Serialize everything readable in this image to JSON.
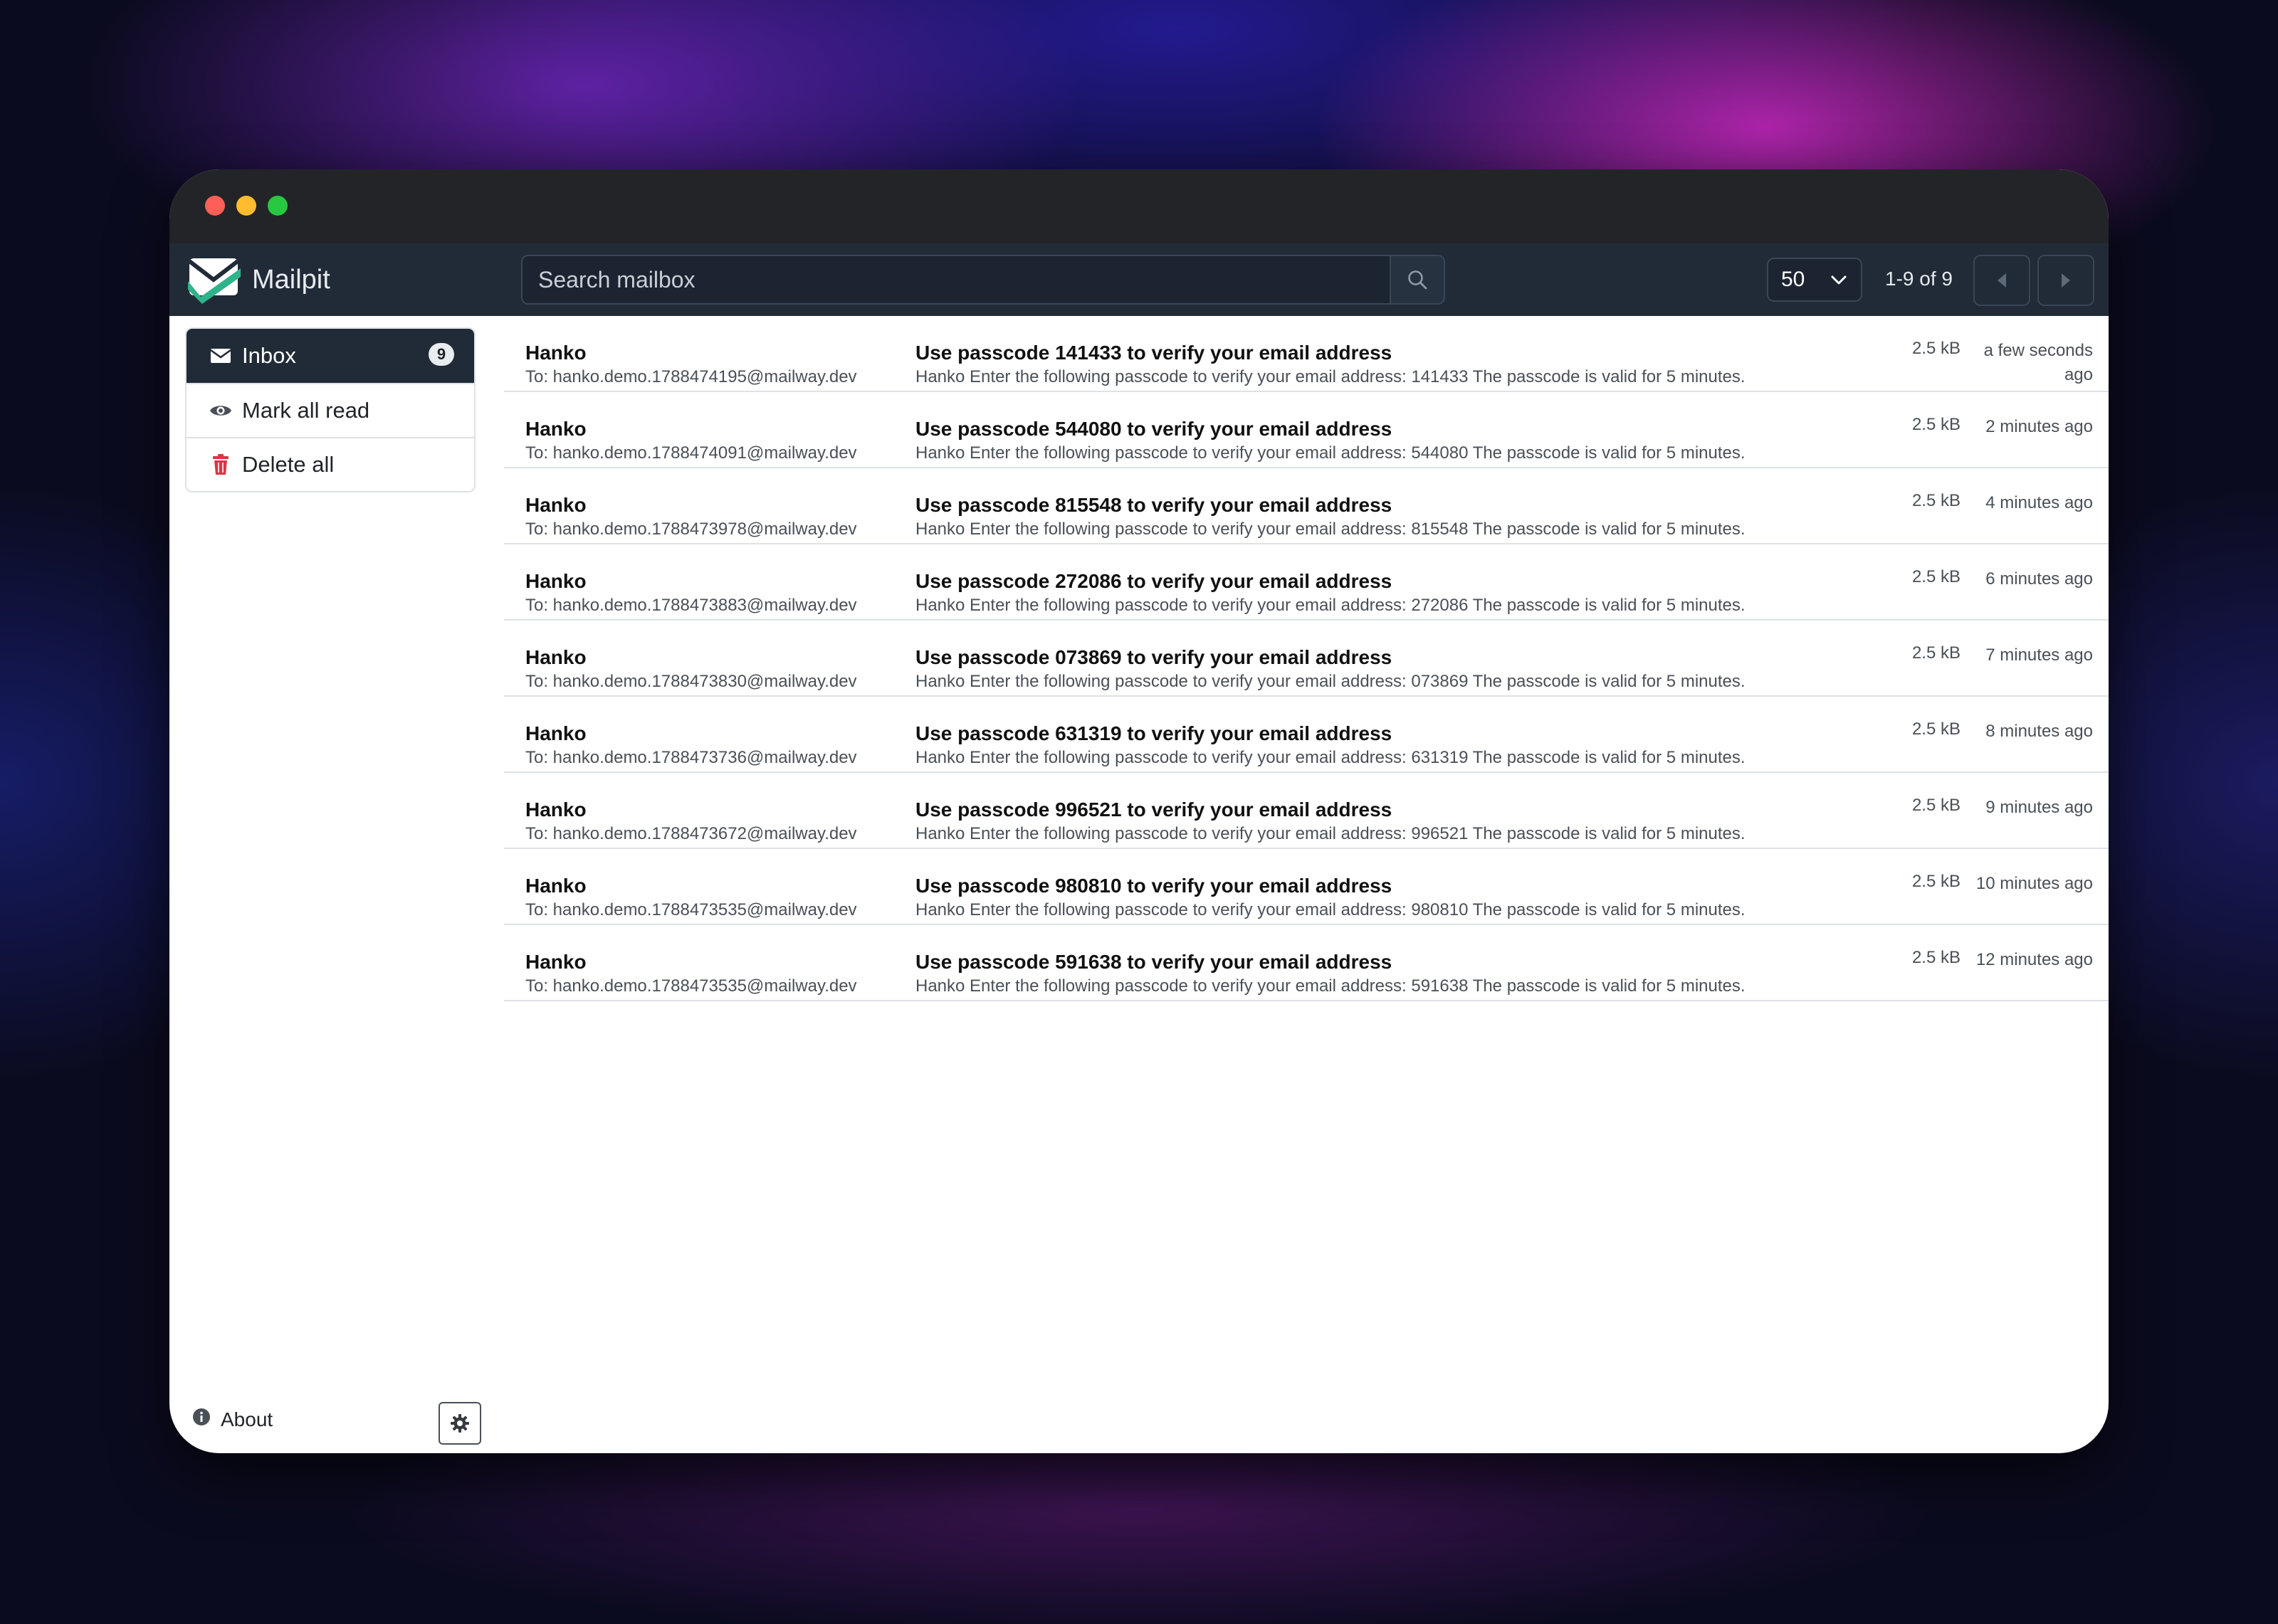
{
  "window": {
    "controls": [
      "close",
      "minimize",
      "zoom"
    ]
  },
  "navbar": {
    "brand_name": "Mailpit",
    "search_placeholder": "Search mailbox",
    "per_page": "50",
    "page_count": "1-9 of 9",
    "icons": {
      "logo": "mailpit-logo-icon",
      "search": "search-icon",
      "prev": "caret-left-icon",
      "next": "caret-right-icon",
      "dropdown": "chevron-down-icon"
    }
  },
  "sidebar": {
    "items": [
      {
        "label": "Inbox",
        "icon": "envelope-icon",
        "badge": "9",
        "active": true
      },
      {
        "label": "Mark all read",
        "icon": "eye-icon"
      },
      {
        "label": "Delete all",
        "icon": "trash-icon"
      }
    ],
    "about_label": "About",
    "colors": {
      "accent": "#212b37",
      "danger": "#dc3545"
    }
  },
  "messages": [
    {
      "from": "Hanko",
      "to": "To: hanko.demo.1788474195@mailway.dev",
      "subject": "Use passcode 141433 to verify your email address",
      "snippet": "Hanko Enter the following passcode to verify your email address: 141433 The passcode is valid for 5 minutes.",
      "size": "2.5 kB",
      "time_line1": "a few seconds",
      "time_line2": "ago"
    },
    {
      "from": "Hanko",
      "to": "To: hanko.demo.1788474091@mailway.dev",
      "subject": "Use passcode 544080 to verify your email address",
      "snippet": "Hanko Enter the following passcode to verify your email address: 544080 The passcode is valid for 5 minutes.",
      "size": "2.5 kB",
      "time_line1": "2 minutes ago",
      "time_line2": ""
    },
    {
      "from": "Hanko",
      "to": "To: hanko.demo.1788473978@mailway.dev",
      "subject": "Use passcode 815548 to verify your email address",
      "snippet": "Hanko Enter the following passcode to verify your email address: 815548 The passcode is valid for 5 minutes.",
      "size": "2.5 kB",
      "time_line1": "4 minutes ago",
      "time_line2": ""
    },
    {
      "from": "Hanko",
      "to": "To: hanko.demo.1788473883@mailway.dev",
      "subject": "Use passcode 272086 to verify your email address",
      "snippet": "Hanko Enter the following passcode to verify your email address: 272086 The passcode is valid for 5 minutes.",
      "size": "2.5 kB",
      "time_line1": "6 minutes ago",
      "time_line2": ""
    },
    {
      "from": "Hanko",
      "to": "To: hanko.demo.1788473830@mailway.dev",
      "subject": "Use passcode 073869 to verify your email address",
      "snippet": "Hanko Enter the following passcode to verify your email address: 073869 The passcode is valid for 5 minutes.",
      "size": "2.5 kB",
      "time_line1": "7 minutes ago",
      "time_line2": ""
    },
    {
      "from": "Hanko",
      "to": "To: hanko.demo.1788473736@mailway.dev",
      "subject": "Use passcode 631319 to verify your email address",
      "snippet": "Hanko Enter the following passcode to verify your email address: 631319 The passcode is valid for 5 minutes.",
      "size": "2.5 kB",
      "time_line1": "8 minutes ago",
      "time_line2": ""
    },
    {
      "from": "Hanko",
      "to": "To: hanko.demo.1788473672@mailway.dev",
      "subject": "Use passcode 996521 to verify your email address",
      "snippet": "Hanko Enter the following passcode to verify your email address: 996521 The passcode is valid for 5 minutes.",
      "size": "2.5 kB",
      "time_line1": "9 minutes ago",
      "time_line2": ""
    },
    {
      "from": "Hanko",
      "to": "To: hanko.demo.1788473535@mailway.dev",
      "subject": "Use passcode 980810 to verify your email address",
      "snippet": "Hanko Enter the following passcode to verify your email address: 980810 The passcode is valid for 5 minutes.",
      "size": "2.5 kB",
      "time_line1": "10 minutes ago",
      "time_line2": ""
    },
    {
      "from": "Hanko",
      "to": "To: hanko.demo.1788473535@mailway.dev",
      "subject": "Use passcode 591638 to verify your email address",
      "snippet": "Hanko Enter the following passcode to verify your email address: 591638 The passcode is valid for 5 minutes.",
      "size": "2.5 kB",
      "time_line1": "12 minutes ago",
      "time_line2": ""
    }
  ]
}
